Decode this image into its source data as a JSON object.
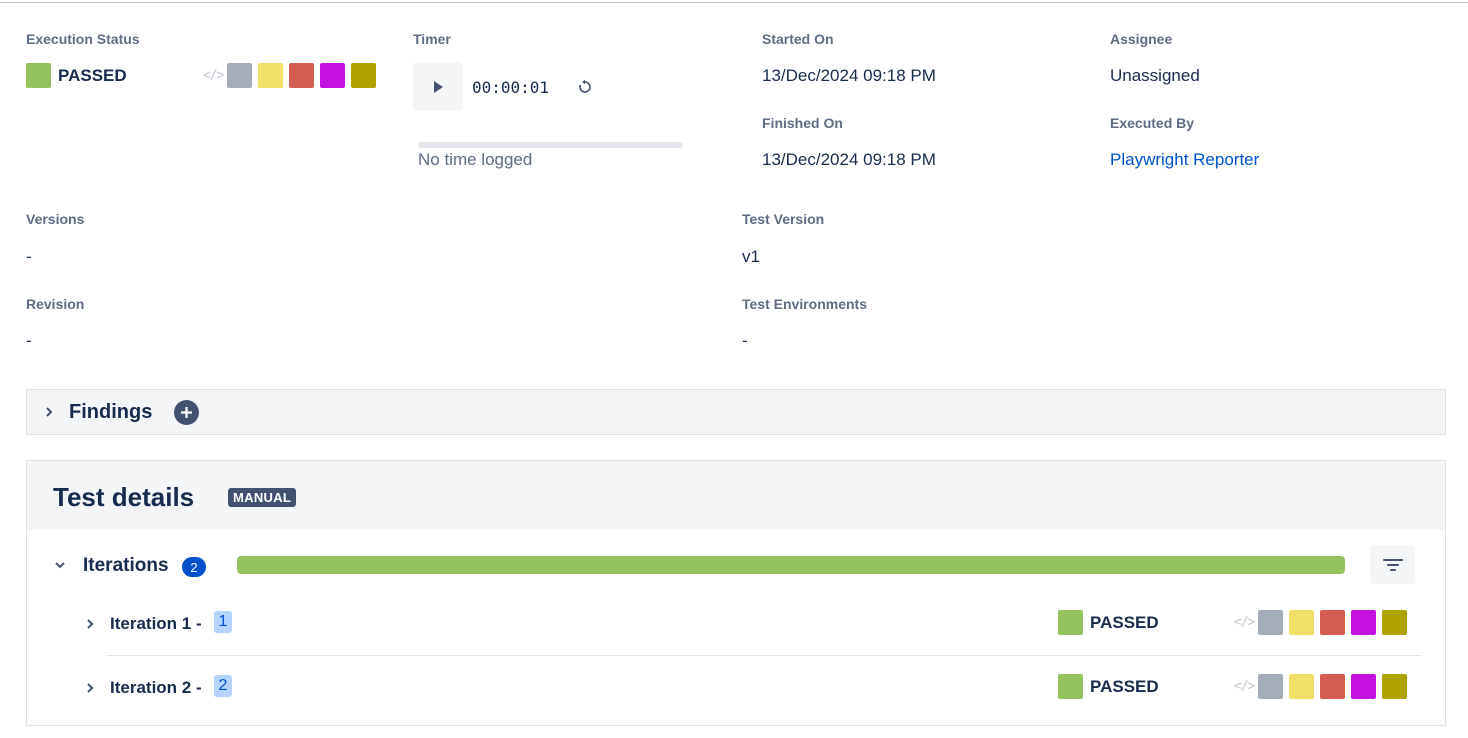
{
  "info": {
    "execution_status_label": "Execution Status",
    "execution_status": "PASSED",
    "timer_label": "Timer",
    "timer_value": "00:00:01",
    "timer_note": "No time logged",
    "started_on_label": "Started On",
    "started_on": "13/Dec/2024 09:18 PM",
    "finished_on_label": "Finished On",
    "finished_on": "13/Dec/2024 09:18 PM",
    "assignee_label": "Assignee",
    "assignee": "Unassigned",
    "executed_by_label": "Executed By",
    "executed_by": "Playwright Reporter",
    "versions_label": "Versions",
    "versions": "-",
    "test_version_label": "Test Version",
    "test_version": "v1",
    "revision_label": "Revision",
    "revision": "-",
    "test_environments_label": "Test Environments",
    "test_environments": "-"
  },
  "status_colors": {
    "passed": "#96c25e",
    "todo": "#a5adba",
    "executing": "#f1e068",
    "failed": "#d45d4f",
    "aborted": "#c311e0",
    "blocked": "#b0a300"
  },
  "quick_status_icons": [
    "code-icon",
    "todo",
    "executing",
    "failed",
    "aborted",
    "blocked"
  ],
  "findings": {
    "title": "Findings"
  },
  "test_details": {
    "title": "Test details",
    "badge": "MANUAL",
    "iterations_label": "Iterations",
    "iterations_count": "2",
    "passed_progress": 1.0,
    "iterations": [
      {
        "label": "Iteration 1 -",
        "number": "1",
        "status": "PASSED"
      },
      {
        "label": "Iteration 2 -",
        "number": "2",
        "status": "PASSED"
      }
    ]
  }
}
